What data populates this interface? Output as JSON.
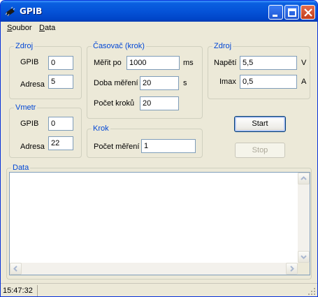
{
  "window": {
    "title": "GPIB"
  },
  "menu": [
    {
      "label": "Soubor"
    },
    {
      "label": "Data"
    }
  ],
  "zdroj_left": {
    "title": "Zdroj",
    "gpib_label": "GPIB",
    "gpib_value": "0",
    "adresa_label": "Adresa",
    "adresa_value": "5"
  },
  "vmetr": {
    "title": "Vmetr",
    "gpib_label": "GPIB",
    "gpib_value": "0",
    "adresa_label": "Adresa",
    "adresa_value": "22"
  },
  "casovac": {
    "title": "Časovač (krok)",
    "merit_label": "Měřit po",
    "merit_value": "1000",
    "merit_unit": "ms",
    "doba_label": "Doba měření",
    "doba_value": "20",
    "doba_unit": "s",
    "pocet_label": "Počet kroků",
    "pocet_value": "20"
  },
  "krok": {
    "title": "Krok",
    "pocet_label": "Počet měření",
    "pocet_value": "1"
  },
  "zdroj_right": {
    "title": "Zdroj",
    "napeti_label": "Napětí",
    "napeti_value": "5,5",
    "napeti_unit": "V",
    "imax_label": "Imax",
    "imax_value": "0,5",
    "imax_unit": "A"
  },
  "buttons": {
    "start": "Start",
    "stop": "Stop"
  },
  "data_group": {
    "title": "Data"
  },
  "status": {
    "time": "15:47:32"
  }
}
